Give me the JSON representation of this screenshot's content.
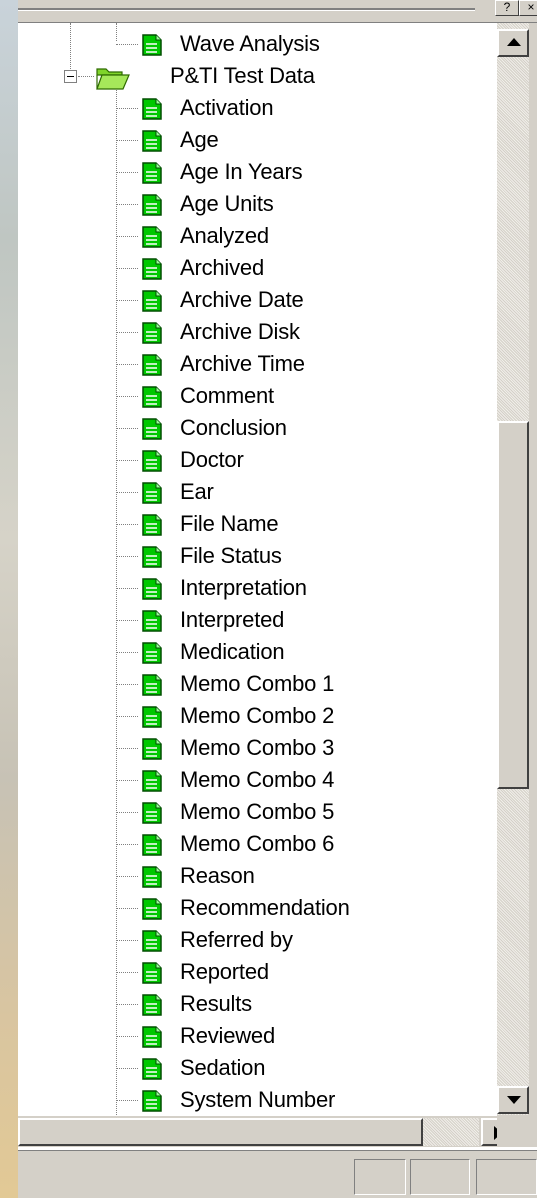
{
  "tree": {
    "scrolled_item": "Wave Analysis",
    "folder": {
      "label": "P&TI Test Data",
      "expanded": true,
      "icon": "open-folder-icon",
      "items": [
        "Activation",
        "Age",
        "Age In Years",
        "Age Units",
        "Analyzed",
        "Archived",
        "Archive Date",
        "Archive Disk",
        "Archive Time",
        "Comment",
        "Conclusion",
        "Doctor",
        "Ear",
        "File Name",
        "File Status",
        "Interpretation",
        "Interpreted",
        "Medication",
        "Memo Combo 1",
        "Memo Combo 2",
        "Memo Combo 3",
        "Memo Combo 4",
        "Memo Combo 5",
        "Memo Combo 6",
        "Reason",
        "Recommendation",
        "Referred by",
        "Reported",
        "Results",
        "Reviewed",
        "Sedation",
        "System Number"
      ]
    },
    "item_icon": "green-document-icon"
  },
  "scrollbar": {
    "vertical_position": 0.55,
    "up_icon": "up-arrow-icon",
    "down_icon": "down-arrow-icon",
    "right_icon": "right-arrow-icon"
  },
  "colors": {
    "doc_green": "#00c800",
    "folder_green": "#7fd42a",
    "chrome": "#d4d0c8"
  }
}
